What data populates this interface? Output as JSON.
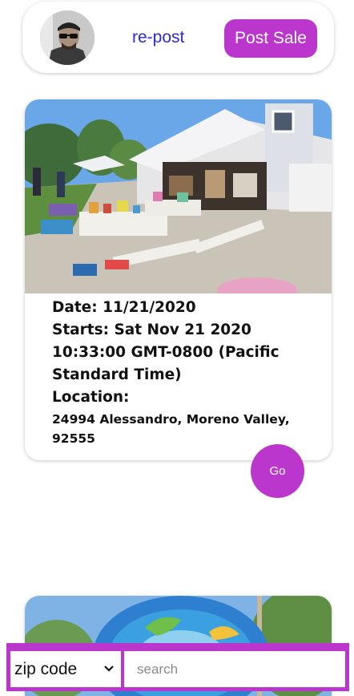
{
  "header": {
    "repost_label": "re-post",
    "post_sale_label": "Post Sale"
  },
  "sales": [
    {
      "date": "Date: 11/21/2020",
      "starts": "Starts: Sat Nov 21 2020 10:33:00 GMT-0800 (Pacific Standard Time)",
      "location_label": "Location:",
      "address": "24994 Alessandro, Moreno Valley, 92555",
      "go_label": "Go"
    }
  ],
  "search": {
    "filter_selected": "zip code",
    "placeholder": "search"
  },
  "colors": {
    "accent": "#bb36cc",
    "link": "#2a2ae0"
  },
  "icons": {
    "select_caret": "chevron-down-icon"
  }
}
